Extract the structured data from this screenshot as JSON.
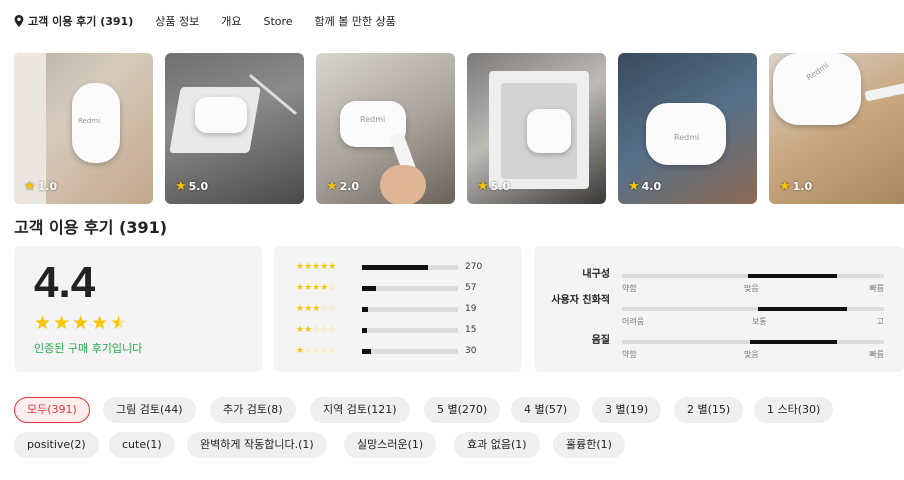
{
  "nav": {
    "items": [
      {
        "label": "고객 이용 후기 (391)",
        "active": true
      },
      {
        "label": "상품 정보",
        "active": false
      },
      {
        "label": "개요",
        "active": false
      },
      {
        "label": "Store",
        "active": false
      },
      {
        "label": "함께 볼 만한 상품",
        "active": false
      }
    ]
  },
  "photos": [
    {
      "rating": "1.0",
      "case_text": "Redmi"
    },
    {
      "rating": "5.0",
      "case_text": ""
    },
    {
      "rating": "2.0",
      "case_text": "Redmi"
    },
    {
      "rating": "5.0",
      "case_text": ""
    },
    {
      "rating": "4.0",
      "case_text": "Redmi"
    },
    {
      "rating": "1.0",
      "case_text": "Redmi"
    }
  ],
  "reviews": {
    "title": "고객 이용 후기 (391)",
    "average": "4.4",
    "average_stars": 4.5,
    "verified_text": "인증된 구매 후기입니다",
    "distribution": [
      {
        "stars": 5,
        "count": "270",
        "fraction": 0.69
      },
      {
        "stars": 4,
        "count": "57",
        "fraction": 0.15
      },
      {
        "stars": 3,
        "count": "19",
        "fraction": 0.06
      },
      {
        "stars": 2,
        "count": "15",
        "fraction": 0.05
      },
      {
        "stars": 1,
        "count": "30",
        "fraction": 0.09
      }
    ],
    "attributes": [
      {
        "label": "내구성",
        "low": "약함",
        "mid": "맞음",
        "high": "빠름",
        "from": 0.48,
        "to": 0.82
      },
      {
        "label": "사용자 친화적",
        "low": "어려움",
        "mid": "보통",
        "high": "고",
        "from": 0.52,
        "to": 0.86
      },
      {
        "label": "음질",
        "low": "약함",
        "mid": "맞음",
        "high": "빠름",
        "from": 0.49,
        "to": 0.82
      }
    ]
  },
  "filters": {
    "row1": [
      {
        "label": "모두(391)",
        "active": true
      },
      {
        "label": "그림 검토(44)",
        "active": false
      },
      {
        "label": "추가 검토(8)",
        "active": false
      },
      {
        "label": "지역 검토(121)",
        "active": false
      },
      {
        "label": "5 별(270)",
        "active": false
      },
      {
        "label": "4 별(57)",
        "active": false
      },
      {
        "label": "3 별(19)",
        "active": false
      },
      {
        "label": "2 별(15)",
        "active": false
      },
      {
        "label": "1 스타(30)",
        "active": false
      }
    ],
    "row2": [
      {
        "label": "positive(2)",
        "active": false
      },
      {
        "label": "cute(1)",
        "active": false
      },
      {
        "label": "완벽하게 작동합니다.(1)",
        "active": false
      },
      {
        "label": "실망스러운(1)",
        "active": false
      },
      {
        "label": "효과 없음(1)",
        "active": false
      },
      {
        "label": "훌륭한(1)",
        "active": false
      }
    ]
  },
  "colors": {
    "star": "#f7c600",
    "accent_red": "#e6333a",
    "verified_green": "#22a94d",
    "card_bg": "#f4f4f4",
    "chip_bg": "#efefef"
  },
  "icons": {
    "nav_pin": "location-pin-icon",
    "rating_star": "star-icon"
  }
}
